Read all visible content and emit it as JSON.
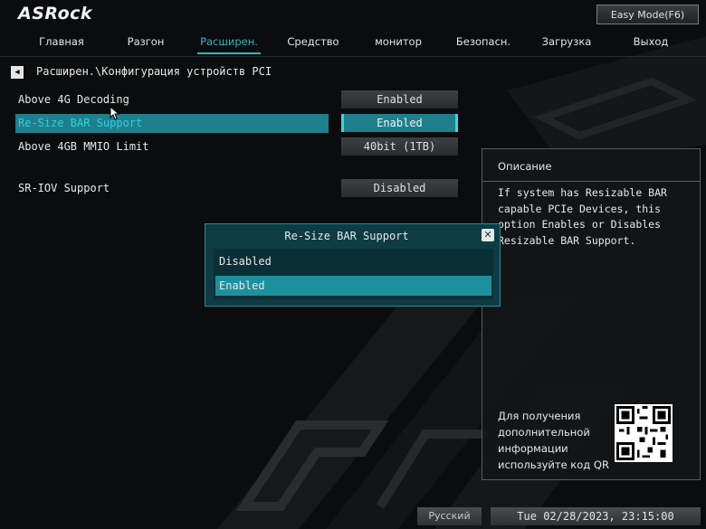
{
  "header": {
    "logo": "ASRock",
    "easy_mode_label": "Easy Mode(F6)"
  },
  "menu": {
    "tabs": [
      {
        "label": "Главная"
      },
      {
        "label": "Разгон"
      },
      {
        "label": "Расширен."
      },
      {
        "label": "Средство"
      },
      {
        "label": "монитор"
      },
      {
        "label": "Безопасн."
      },
      {
        "label": "Загрузка"
      },
      {
        "label": "Выход"
      }
    ],
    "active_tab": "Расширен."
  },
  "breadcrumb": {
    "back_icon": "back-arrow-icon",
    "text": "Расширен.\\Конфигурация устройств PCI"
  },
  "settings": [
    {
      "label": "Above 4G Decoding",
      "value": "Enabled"
    },
    {
      "label": "Re-Size BAR Support",
      "value": "Enabled",
      "selected": true
    },
    {
      "label": "Above 4GB MMIO Limit",
      "value": "40bit (1TB)"
    },
    {
      "label": "SR-IOV Support",
      "value": "Disabled"
    }
  ],
  "popup": {
    "title": "Re-Size BAR Support",
    "close_icon": "close-icon",
    "options": [
      "Disabled",
      "Enabled"
    ],
    "selected_option": "Enabled"
  },
  "description": {
    "title": "Описание",
    "text": "If system has Resizable BAR capable PCIe Devices, this option Enables or Disables Resizable BAR Support.",
    "qr_text": "Для получения дополнительной информации используйте код QR"
  },
  "footer": {
    "language": "Русский",
    "datetime": "Tue 02/28/2023, 23:15:00"
  },
  "colors": {
    "accent": "#2fb6c6",
    "selection": "#1f7f8c",
    "background": "#0b0c0d"
  }
}
